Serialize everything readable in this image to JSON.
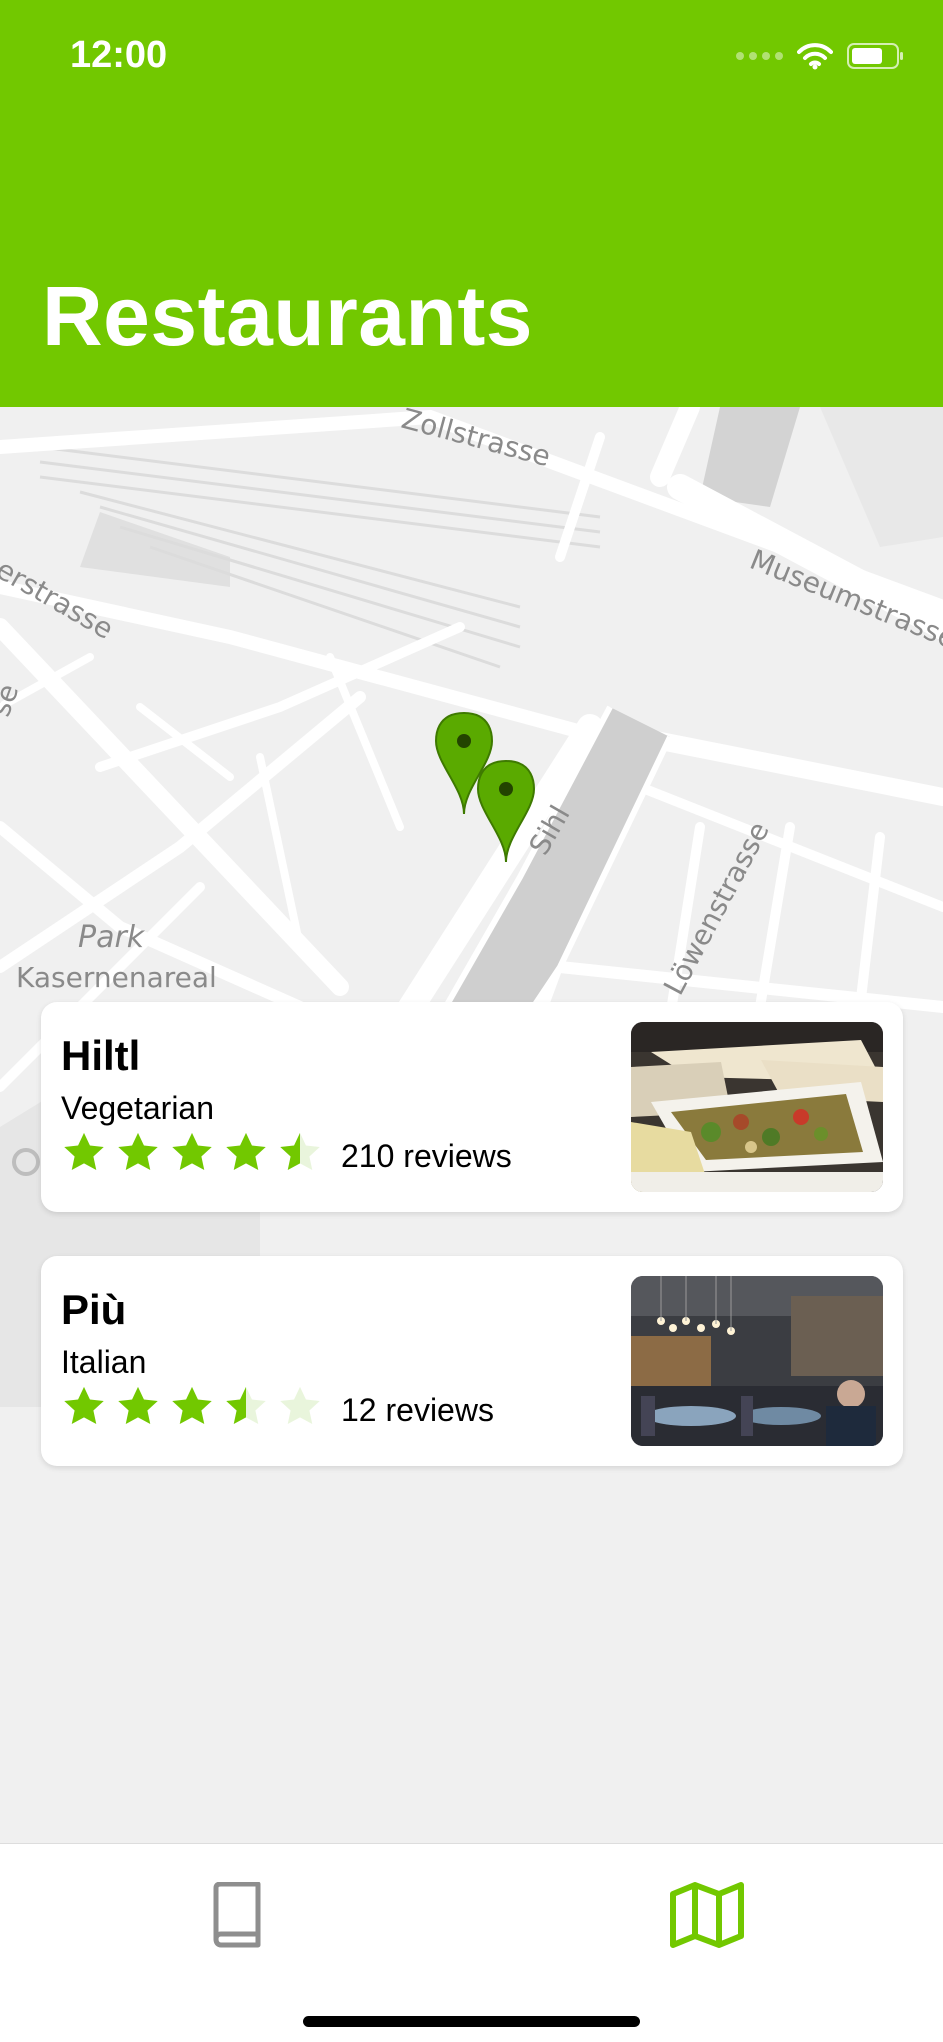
{
  "status_bar": {
    "time": "12:00"
  },
  "header": {
    "title": "Restaurants"
  },
  "map": {
    "labels": {
      "street_top": "Zollstrasse",
      "museum": "Museumstrasse",
      "left_street": "erstrasse",
      "left_edge": "se",
      "river": "Sihl",
      "lowen": "Löwenstrasse",
      "park": "Park",
      "kasernenareal": "Kasernenareal"
    },
    "pin_color": "#5aaa00"
  },
  "restaurants": [
    {
      "name": "Hiltl",
      "category": "Vegetarian",
      "rating": 4.5,
      "reviews": "210 reviews"
    },
    {
      "name": "Più",
      "category": "Italian",
      "rating": 3.5,
      "reviews": "12 reviews"
    }
  ],
  "tabbar": {
    "tabs": [
      {
        "icon": "book-icon",
        "active": false
      },
      {
        "icon": "map-icon",
        "active": true
      }
    ]
  },
  "colors": {
    "accent": "#72c800",
    "inactive": "#8e8e8e"
  }
}
